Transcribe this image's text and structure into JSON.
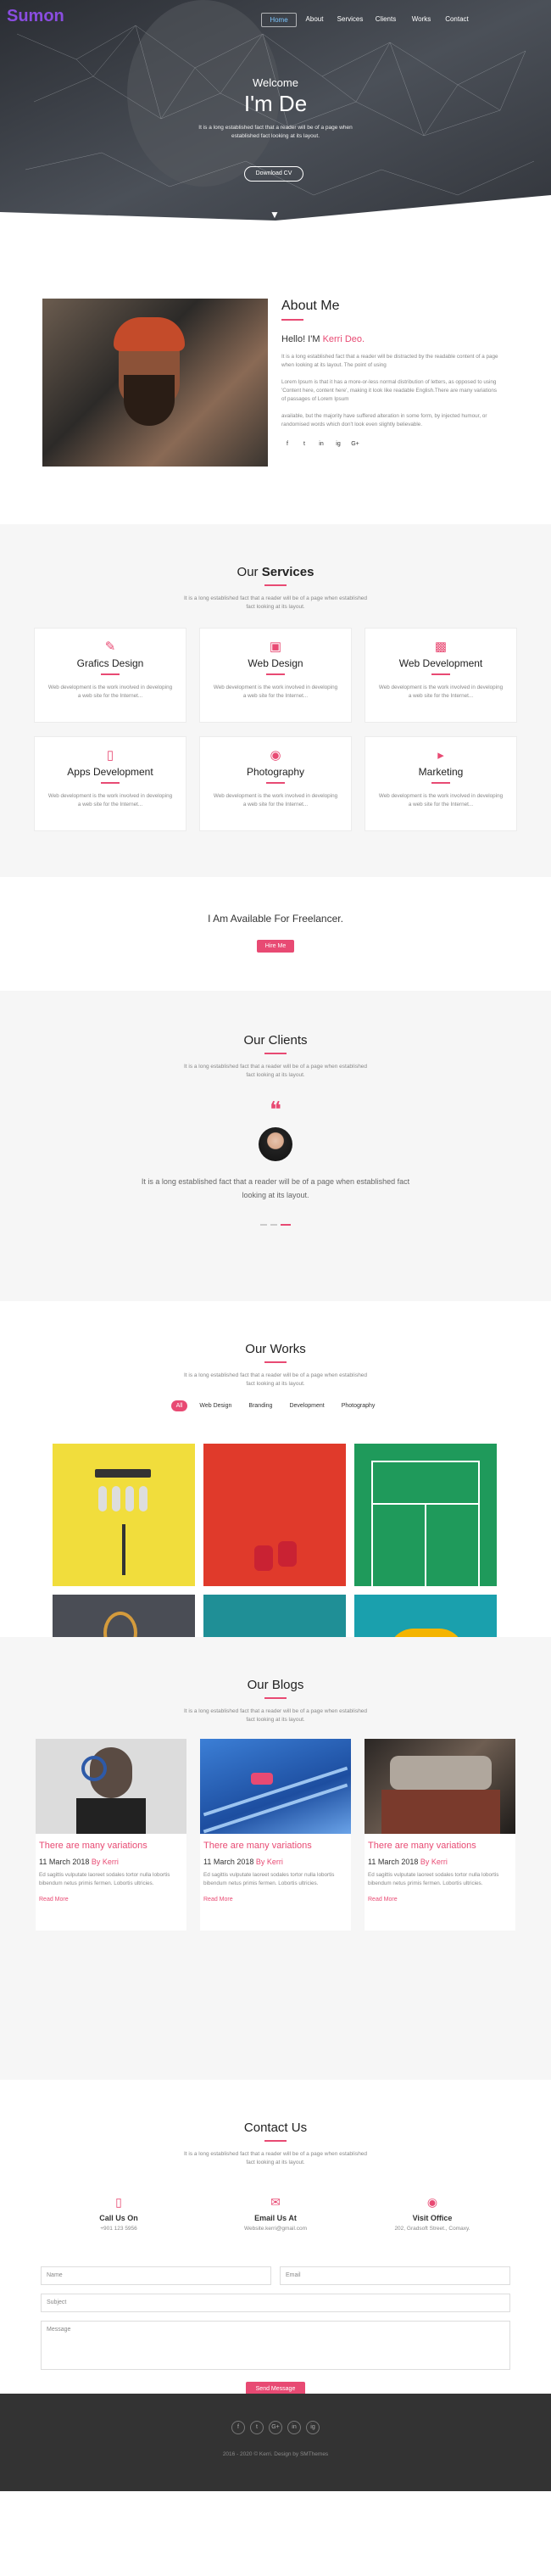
{
  "nav": {
    "logo": "Sumon",
    "items": [
      "Home",
      "About",
      "Services",
      "Clients",
      "Works",
      "Contact"
    ]
  },
  "hero": {
    "welcome": "Welcome",
    "name": "I'm De",
    "desc": "It is a long established fact that a reader will be of a page when established fact looking at its layout.",
    "cv": "Download CV"
  },
  "about": {
    "title": "About Me",
    "hello": "Hello! I'M",
    "name": "Kerri Deo.",
    "p1": "It is a long established fact that a reader will be distracted by the readable content of a page when looking at its layout. The point of using",
    "p2": "Lorem Ipsum is that it has a more-or-less normal distribution of letters, as opposed to using 'Content here, content here', making it look like readable English.There are many variations of passages of Lorem Ipsum",
    "p3": "available, but the majority have suffered alteration in some form, by injected humour, or randomised words which don't look even slightly believable.",
    "social": [
      "f",
      "t",
      "in",
      "ig",
      "G+"
    ]
  },
  "services": {
    "title_a": "Our",
    "title_b": "Services",
    "sub": "It is a long established fact that a reader will be of a page when established fact looking at its layout.",
    "items": [
      {
        "title": "Grafics Design",
        "desc": "Web development is the work involved in developing a web site for the Internet..."
      },
      {
        "title": "Web Design",
        "desc": "Web development is the work involved in developing a web site for the Internet..."
      },
      {
        "title": "Web Development",
        "desc": "Web development is the work involved in developing a web site for the Internet..."
      },
      {
        "title": "Apps Development",
        "desc": "Web development is the work involved in developing a web site for the Internet..."
      },
      {
        "title": "Photography",
        "desc": "Web development is the work involved in developing a web site for the Internet..."
      },
      {
        "title": "Marketing",
        "desc": "Web development is the work involved in developing a web site for the Internet..."
      }
    ]
  },
  "freelance": {
    "title": "I Am Available For Freelancer.",
    "button": "Hire Me"
  },
  "clients": {
    "title": "Our Clients",
    "sub": "It is a long established fact that a reader will be of a page when established fact looking at its layout.",
    "quote": "It is a long established fact that a reader will be of a page when established fact looking at its layout."
  },
  "works": {
    "title": "Our Works",
    "sub": "It is a long established fact that a reader will be of a page when established fact looking at its layout.",
    "filters": [
      "All",
      "Web Design",
      "Branding",
      "Development",
      "Photography"
    ]
  },
  "blogs": {
    "title": "Our Blogs",
    "sub": "It is a long established fact that a reader will be of a page when established fact looking at its layout.",
    "items": [
      {
        "title": "There are many variations",
        "date": "11 March 2018",
        "by": "By Kerri",
        "desc": "Ed sagittis vulputate laoreet sodales tortor nulla lobortis bibendum netus primis fermen. Lobortis ultricies.",
        "more": "Read More"
      },
      {
        "title": "There are many variations",
        "date": "11 March 2018",
        "by": "By Kerri",
        "desc": "Ed sagittis vulputate laoreet sodales tortor nulla lobortis bibendum netus primis fermen. Lobortis ultricies.",
        "more": "Read More"
      },
      {
        "title": "There are many variations",
        "date": "11 March 2018",
        "by": "By Kerri",
        "desc": "Ed sagittis vulputate laoreet sodales tortor nulla lobortis bibendum netus primis fermen. Lobortis ultricies.",
        "more": "Read More"
      }
    ]
  },
  "contact": {
    "title": "Contact Us",
    "sub": "It is a long established fact that a reader will be of a page when established fact looking at its layout.",
    "call_title": "Call Us On",
    "call_value": "+901 123 5956",
    "email_title": "Email Us At",
    "email_value": "Website.kerri@gmail.com",
    "visit_title": "Visit Office",
    "visit_value": "202, Gradsoft Street., Comaxy.",
    "name_ph": "Name",
    "email_ph": "Email",
    "subject_ph": "Subject",
    "message_ph": "Message",
    "send": "Send Message"
  },
  "footer": {
    "social": [
      "f",
      "t",
      "G+",
      "in",
      "ig"
    ],
    "copy": "2016 - 2020 © Kerri. Design by SMThemes"
  },
  "colors": {
    "accent": "#e84a73",
    "logo": "#8a4de0",
    "footer": "#333333"
  }
}
